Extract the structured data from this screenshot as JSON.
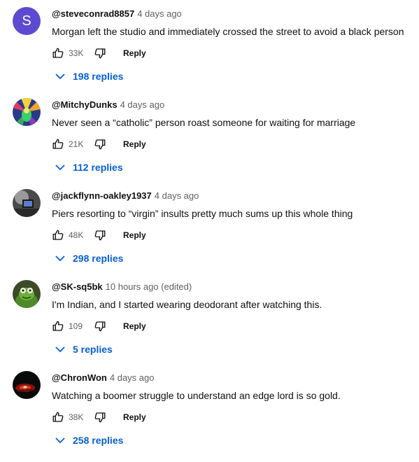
{
  "comments": [
    {
      "author": "@steveconrad8857",
      "time": "4 days ago",
      "text": "Morgan left the studio and immediately crossed the street to avoid a black person",
      "likes": "33K",
      "reply_label": "Reply",
      "replies_label": "198 replies",
      "avatar_letter": "S",
      "avatar_color": "#5c4bd0"
    },
    {
      "author": "@MitchyDunks",
      "time": "4 days ago",
      "text": "Never seen a “catholic” person roast someone for waiting for marriage",
      "likes": "21K",
      "reply_label": "Reply",
      "replies_label": "112 replies"
    },
    {
      "author": "@jackflynn-oakley1937",
      "time": "4 days ago",
      "text": "Piers resorting to “virgin” insults pretty much sums up this whole thing",
      "likes": "48K",
      "reply_label": "Reply",
      "replies_label": "298 replies"
    },
    {
      "author": "@SK-sq5bk",
      "time": "10 hours ago (edited)",
      "text": "I'm Indian, and I started wearing deodorant after watching this.",
      "likes": "109",
      "reply_label": "Reply",
      "replies_label": "5 replies"
    },
    {
      "author": "@ChronWon",
      "time": "4 days ago",
      "text": "Watching a boomer struggle to understand an edge lord is so gold.",
      "likes": "38K",
      "reply_label": "Reply",
      "replies_label": "258 replies"
    }
  ],
  "colors": {
    "link_blue": "#065fd4",
    "secondary_text": "#606060"
  },
  "icons": {
    "like": "thumbs-up-icon",
    "dislike": "thumbs-down-icon",
    "expand": "chevron-down-icon"
  }
}
